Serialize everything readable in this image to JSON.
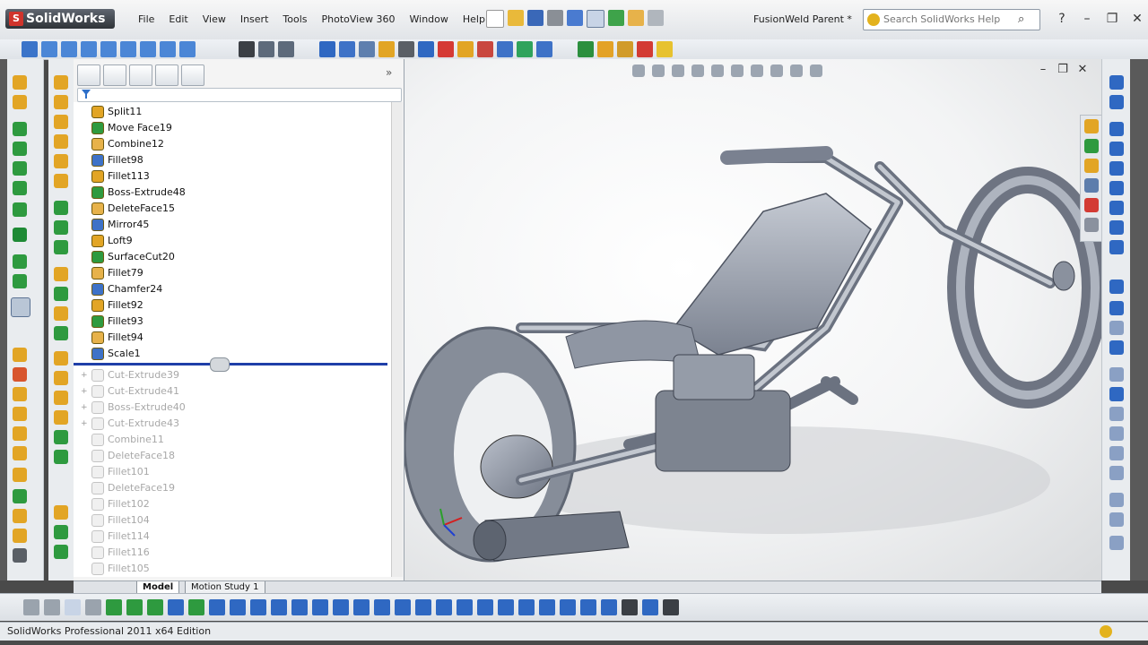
{
  "app": {
    "logo": "SolidWorks",
    "logo_mark": "S"
  },
  "menu": [
    "File",
    "Edit",
    "View",
    "Insert",
    "Tools",
    "PhotoView 360",
    "Window",
    "Help"
  ],
  "document": {
    "title": "FusionWeld Parent *"
  },
  "search": {
    "placeholder": "Search SolidWorks Help"
  },
  "window_controls": [
    "?",
    "–",
    "❐",
    "✕"
  ],
  "feature_tree": {
    "active": [
      "Split11",
      "Move Face19",
      "Combine12",
      "Fillet98",
      "Fillet113",
      "Boss-Extrude48",
      "DeleteFace15",
      "Mirror45",
      "Loft9",
      "SurfaceCut20",
      "Fillet79",
      "Chamfer24",
      "Fillet92",
      "Fillet93",
      "Fillet94",
      "Scale1"
    ],
    "suppressed": [
      "Cut-Extrude39",
      "Cut-Extrude41",
      "Boss-Extrude40",
      "Cut-Extrude43",
      "Combine11",
      "DeleteFace18",
      "Fillet101",
      "DeleteFace19",
      "Fillet102",
      "Fillet104",
      "Fillet114",
      "Fillet116",
      "Fillet105"
    ]
  },
  "bottom_tabs": [
    "Model",
    "Motion Study 1"
  ],
  "statusbar": {
    "text": "SolidWorks Professional 2011 x64 Edition"
  },
  "viewport_controls": [
    "–",
    "❐",
    "✕"
  ],
  "panel_expand": "»",
  "colors": {
    "rollback": "#1f3fa8",
    "logo_red": "#d0342c",
    "model_gray": "#9aa1ad"
  }
}
